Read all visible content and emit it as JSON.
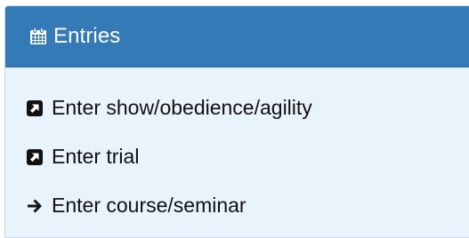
{
  "panel": {
    "title": "Entries",
    "title_icon": "calendar-icon",
    "header_bg": "#337ab7",
    "body_bg": "#e9f3fb"
  },
  "entries": [
    {
      "label": "Enter show/obedience/agility",
      "icon": "external-link-square-icon"
    },
    {
      "label": "Enter trial",
      "icon": "external-link-square-icon"
    },
    {
      "label": "Enter course/seminar",
      "icon": "arrow-right-icon"
    }
  ]
}
